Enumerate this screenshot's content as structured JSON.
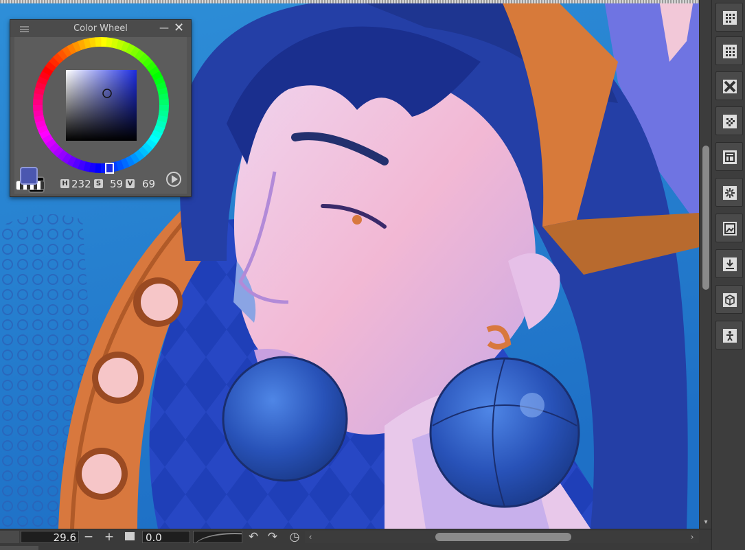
{
  "color_wheel_panel": {
    "title": "Color Wheel",
    "minimize_glyph": "—",
    "close_glyph": "✕",
    "hue_tag": "H",
    "hue_value": "232",
    "saturation_tag": "S",
    "saturation_value": "59",
    "value_tag": "V",
    "value_value": "69",
    "main_color": "#4b57b0",
    "sub_color": "#000000"
  },
  "status_bar": {
    "zoom_value": "29.6",
    "zoom_minus_glyph": "−",
    "zoom_plus_glyph": "+",
    "rotation_value": "0.0",
    "rotate_ccw_glyph": "↶",
    "rotate_cw_glyph": "↷",
    "rotate_reset_glyph": "◷",
    "scroll_left_glyph": "‹",
    "scroll_right_glyph": "›"
  },
  "vertical_scrollbar": {
    "down_glyph": "▾"
  },
  "right_toolbar": {
    "buttons": [
      {
        "icon": "grid-dots-icon"
      },
      {
        "icon": "grid-dots-alt-icon"
      },
      {
        "icon": "transform-x-icon"
      },
      {
        "icon": "checker-grid-icon"
      },
      {
        "icon": "layout-icon"
      },
      {
        "icon": "scatter-icon"
      },
      {
        "icon": "image-frame-icon"
      },
      {
        "icon": "import-icon"
      },
      {
        "icon": "cube-icon"
      },
      {
        "icon": "figure-icon"
      }
    ]
  }
}
